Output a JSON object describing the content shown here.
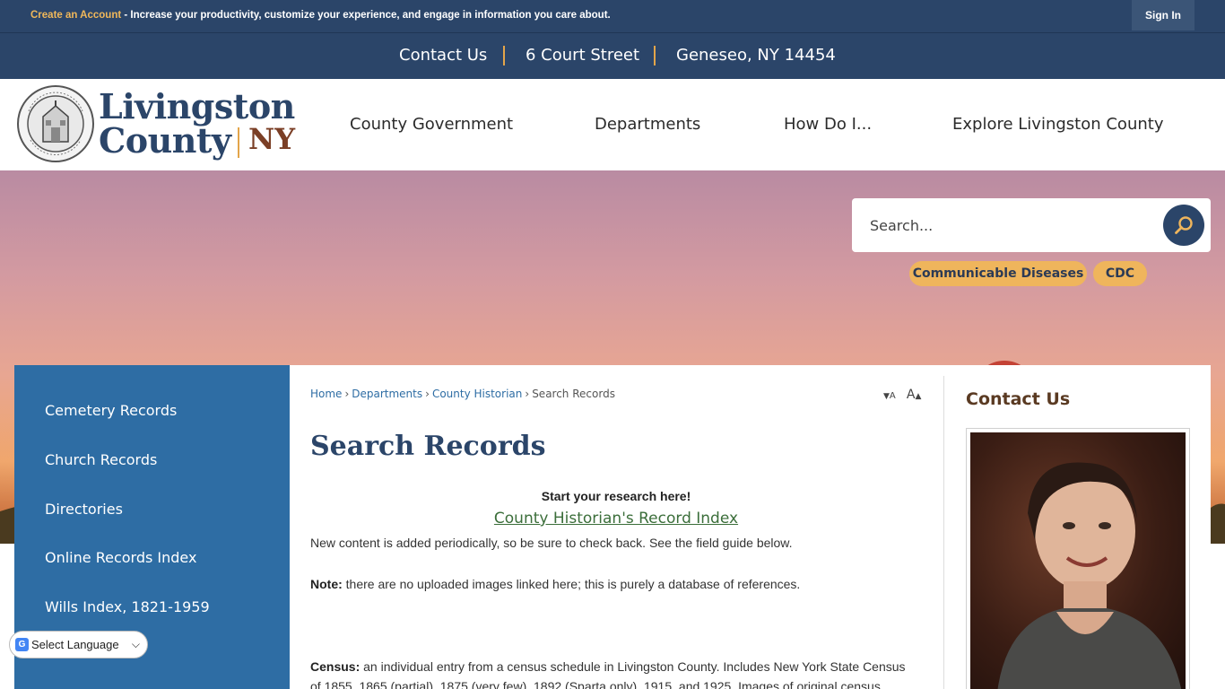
{
  "topbar": {
    "create_link": "Create an Account",
    "create_text": " - Increase your productivity, customize your experience, and engage in information you care about.",
    "signin_label": "Sign In"
  },
  "contact_bar": {
    "contact_label": "Contact Us",
    "street": "6 Court Street",
    "city": "Geneseo, NY 14454"
  },
  "logo": {
    "line1": "Livingston",
    "line2": "County",
    "state": "NY"
  },
  "nav": {
    "items": [
      "County Government",
      "Departments",
      "How Do I...",
      "Explore Livingston County"
    ]
  },
  "search": {
    "placeholder": "Search..."
  },
  "quick_links": [
    "Communicable Diseases",
    "CDC"
  ],
  "sidebar": {
    "items": [
      "Cemetery Records",
      "Church Records",
      "Directories",
      "Online Records Index",
      "Wills Index, 1821-1959"
    ]
  },
  "translate": {
    "label": "Select Language"
  },
  "breadcrumb": {
    "items": [
      "Home",
      "Departments",
      "County Historian",
      "Search Records"
    ]
  },
  "font_resize": {
    "decrease": "A",
    "increase": "A"
  },
  "page": {
    "title": "Search Records",
    "start": "Start your research here!",
    "index_link": "County Historian's Record Index",
    "line1": "New content is added periodically, so be sure to check back. See the field guide below.",
    "note_label": "Note:",
    "note_text": " there are no uploaded images linked here; this is purely a database of references.",
    "census_label": "Census:",
    "census_text": " an individual entry from a census schedule in Livingston County. Includes New York State Census",
    "census_text2": "of 1855, 1865 (partial), 1875 (very few), 1892 (Sparta only), 1915, and 1925. Images of original census"
  },
  "right_column": {
    "heading": "Contact Us"
  },
  "colors": {
    "navy": "#2b4569",
    "accent_gold": "#efb55c",
    "sidebar_blue": "#2e6da4",
    "ny_brown": "#7b3f26"
  }
}
